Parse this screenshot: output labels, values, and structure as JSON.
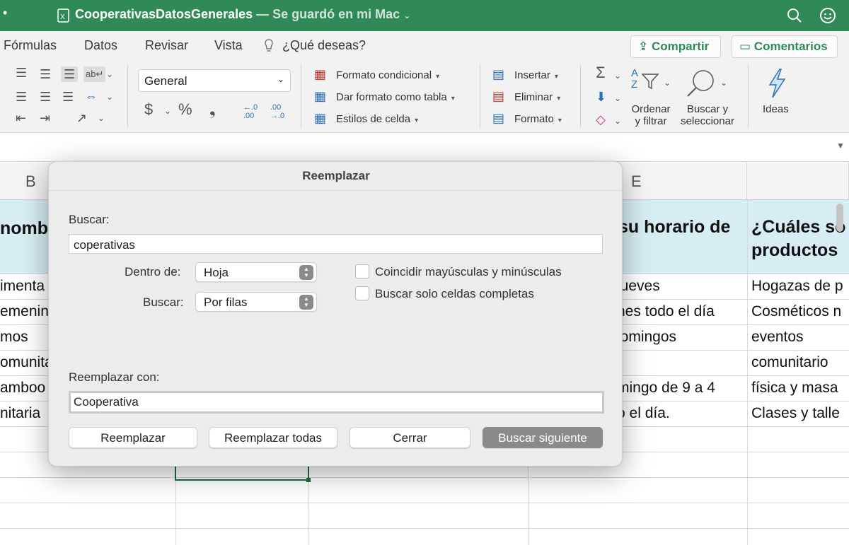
{
  "window": {
    "title": "CooperativasDatosGenerales",
    "saved_status": "— Se guardó en mi Mac"
  },
  "ribbon_tabs": [
    "Fórmulas",
    "Datos",
    "Revisar",
    "Vista"
  ],
  "tell_me": "¿Qué deseas?",
  "share_button": "Compartir",
  "comments_button": "Comentarios",
  "ribbon": {
    "number_format": "General",
    "conditional_format": "Formato condicional",
    "format_as_table": "Dar formato como tabla",
    "cell_styles": "Estilos de celda",
    "insert": "Insertar",
    "delete": "Eliminar",
    "format": "Formato",
    "sort_filter_1": "Ordenar",
    "sort_filter_2": "y filtrar",
    "find_select_1": "Buscar y",
    "find_select_2": "seleccionar",
    "ideas": "Ideas",
    "currency_symbol": "$",
    "percent_symbol": "%"
  },
  "grid": {
    "col_b": "B",
    "col_e": "E",
    "header_b": "nomb",
    "header_e": "su horario de",
    "header_f_1": "¿Cuáles so",
    "header_f_2": "productos",
    "rows": [
      {
        "b": "imenta",
        "e": "jueves",
        "f": "Hogazas de p"
      },
      {
        "b": "emenin",
        "e": "nes todo el día",
        "f": "Cosméticos n"
      },
      {
        "b": "mos",
        "e": "lomingos",
        "f": "eventos"
      },
      {
        "b": "omunita",
        "e": "",
        "f": "comunitario"
      },
      {
        "b": "amboo",
        "e": "mingo de 9 a 4",
        "f": "física y masa"
      },
      {
        "b": "nitaria",
        "e": "o el día.",
        "f": "Clases y talle"
      }
    ]
  },
  "dialog": {
    "title": "Reemplazar",
    "find_label": "Buscar:",
    "find_value": "coperativas",
    "within_label": "Dentro de:",
    "within_value": "Hoja",
    "search_label": "Buscar:",
    "search_value": "Por filas",
    "match_case": "Coincidir mayúsculas y minúsculas",
    "whole_cells": "Buscar solo celdas completas",
    "replace_label": "Reemplazar con:",
    "replace_value": "Cooperativa",
    "btn_replace": "Reemplazar",
    "btn_replace_all": "Reemplazar todas",
    "btn_close": "Cerrar",
    "btn_find_next": "Buscar siguiente"
  },
  "colors": {
    "title_bar": "#2f8a57",
    "header_row": "#d6eef1",
    "accent": "#2f8a57"
  }
}
